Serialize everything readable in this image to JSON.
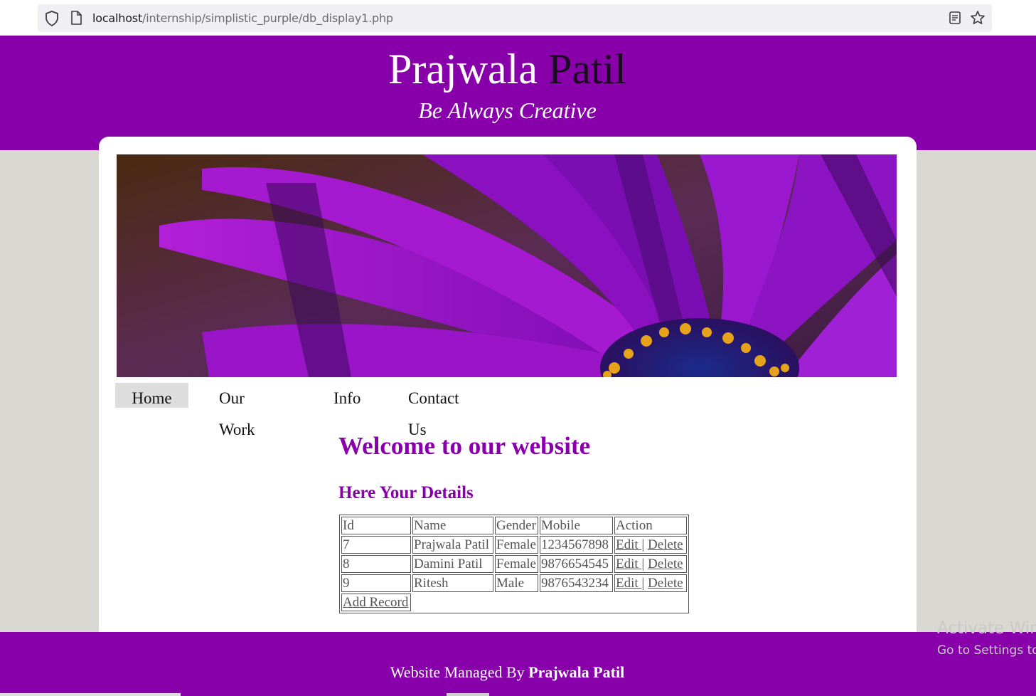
{
  "browser": {
    "url_host": "localhost",
    "url_path": "/internship/simplistic_purple/db_display1.php"
  },
  "header": {
    "title_first": "Prajwala",
    "title_last": "Patil",
    "tagline": "Be Always Creative"
  },
  "nav": {
    "items": [
      "Home",
      "Our Work",
      "Info",
      "Contact Us"
    ],
    "active": "Home"
  },
  "main": {
    "welcome": "Welcome to our website",
    "details_heading": "Here Your Details",
    "table": {
      "headers": [
        "Id",
        "Name",
        "Gender",
        "Mobile",
        "Action"
      ],
      "rows": [
        {
          "id": "7",
          "name": "Prajwala Patil",
          "gender": "Female",
          "mobile": "1234567898"
        },
        {
          "id": "8",
          "name": "Damini Patil",
          "gender": "Female",
          "mobile": "9876654545"
        },
        {
          "id": "9",
          "name": "Ritesh",
          "gender": "Male",
          "mobile": "9876543234"
        }
      ],
      "edit_label": "Edit |",
      "delete_label": "Delete",
      "add_record": "Add Record"
    }
  },
  "watermark": {
    "line1": "Activate Win",
    "line2": "Go to Settings to"
  },
  "footer": {
    "prefix": "Website Managed By",
    "name": "Prajwala Patil"
  },
  "colors": {
    "brand_purple": "#8800aa",
    "page_bg": "#d9d8d2"
  }
}
